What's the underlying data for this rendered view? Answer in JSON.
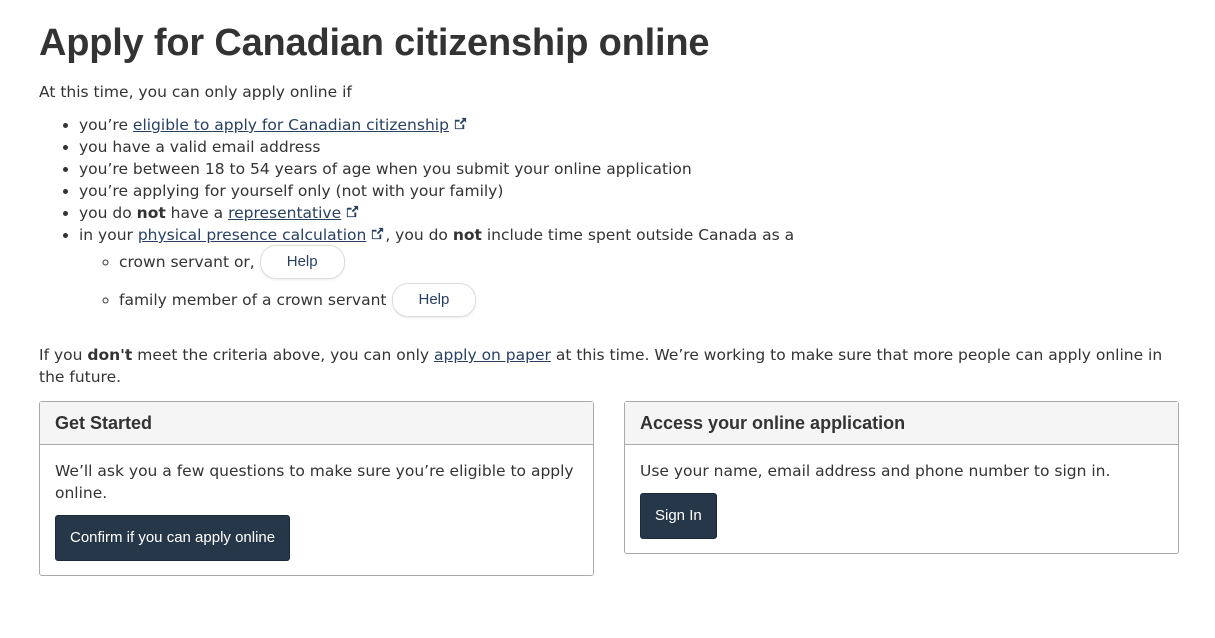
{
  "title": "Apply for Canadian citizenship online",
  "intro": "At this time, you can only apply online if",
  "criteria": {
    "c1_prefix": "you’re ",
    "c1_link": "eligible to apply for Canadian citizenship",
    "c2": "you have a valid email address",
    "c3": "you’re between 18 to 54 years of age when you submit your online application",
    "c4": "you’re applying for yourself only (not with your family)",
    "c5_a": "you do ",
    "c5_b": "not",
    "c5_c": " have a ",
    "c5_link": "representative",
    "c6_a": "in your ",
    "c6_link": "physical presence calculation",
    "c6_b": ", you do ",
    "c6_c": "not",
    "c6_d": " include time spent outside Canada as a",
    "sub1": "crown servant or,",
    "sub2": "family member of a crown servant",
    "help_label": "Help"
  },
  "paper": {
    "a": "If you ",
    "b": "don't",
    "c": " meet the criteria above, you can only ",
    "link": "apply on paper",
    "d": " at this time. We’re working to make sure that more people can apply online in the future."
  },
  "get_started": {
    "heading": "Get Started",
    "text": "We’ll ask you a few questions to make sure you’re eligible to apply online.",
    "button": "Confirm if you can apply online"
  },
  "access": {
    "heading": "Access your online application",
    "text": "Use your name, email address and phone number to sign in.",
    "button": "Sign In"
  },
  "colors": {
    "link": "#284162",
    "button": "#26374a",
    "text": "#333333"
  }
}
